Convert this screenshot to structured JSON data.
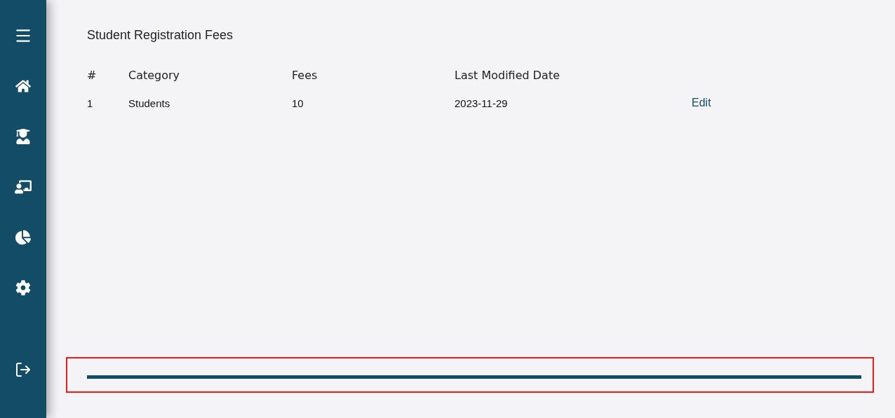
{
  "sidebar": {
    "items": [
      {
        "kind": "menu"
      },
      {
        "kind": "home"
      },
      {
        "kind": "students"
      },
      {
        "kind": "teachers"
      },
      {
        "kind": "reports"
      },
      {
        "kind": "settings"
      },
      {
        "kind": "logout"
      }
    ]
  },
  "page": {
    "title": "Student Registration Fees"
  },
  "table": {
    "columns": [
      "#",
      "Category",
      "Fees",
      "Last Modified Date"
    ],
    "rows": [
      {
        "cells": [
          "1",
          "Students",
          "10",
          "2023-11-29"
        ],
        "action": "Edit"
      }
    ]
  }
}
